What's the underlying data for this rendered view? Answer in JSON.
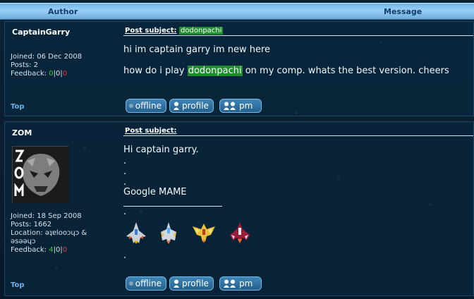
{
  "header": {
    "author": "Author",
    "message": "Message"
  },
  "posts": [
    {
      "author": "CaptainGarry",
      "joined": "Joined: 06 Dec 2008",
      "posts": "Posts: 2",
      "feedback_label": "Feedback:",
      "feedback_pos": "0",
      "feedback_neu": "0",
      "feedback_neg": "0",
      "subject_label": "Post subject:",
      "subject": "dodonpachi",
      "line1": "hi im captain garry im new here",
      "line2_pre": "how do i play ",
      "line2_hl": "dodonpachi",
      "line2_post": " on my comp. whats the best version. cheers",
      "top": "Top",
      "buttons": {
        "offline": "offline",
        "profile": "profile",
        "pm": "pm"
      }
    },
    {
      "author": "ZOM",
      "joined": "Joined: 18 Sep 2008",
      "posts": "Posts: 1662",
      "location": "Location: ǝʇɐlooɔɥɔ & ǝsǝǝɥɔ",
      "feedback_label": "Feedback:",
      "feedback_pos": "4",
      "feedback_neu": "0",
      "feedback_neg": "0",
      "subject_label": "Post subject:",
      "line1": "Hi captain garry.",
      "dot": ".",
      "line_google": "Google MAME",
      "top": "Top",
      "buttons": {
        "offline": "offline",
        "profile": "profile",
        "pm": "pm"
      }
    }
  ],
  "colors": {
    "positive": "#38c83a",
    "negative": "#e23b3b",
    "highlight": "#1f8f2d",
    "link": "#6fb3e6"
  }
}
